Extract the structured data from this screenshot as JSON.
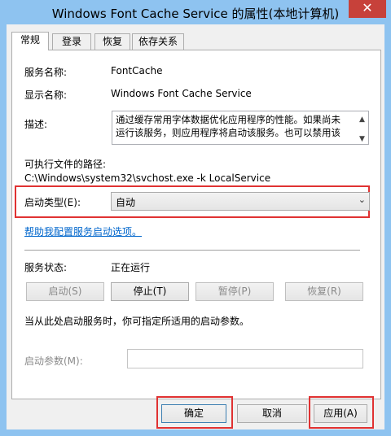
{
  "window": {
    "title": "Windows Font Cache Service 的属性(本地计算机)",
    "close_glyph": "✕"
  },
  "tabs": [
    {
      "label": "常规"
    },
    {
      "label": "登录"
    },
    {
      "label": "恢复"
    },
    {
      "label": "依存关系"
    }
  ],
  "general": {
    "service_name_label": "服务名称:",
    "service_name": "FontCache",
    "display_name_label": "显示名称:",
    "display_name": "Windows Font Cache Service",
    "description_label": "描述:",
    "description_line1": "通过缓存常用字体数据优化应用程序的性能。如果尚未",
    "description_line2": "运行该服务，则应用程序将启动该服务。也可以禁用该",
    "exec_path_label": "可执行文件的路径:",
    "exec_path": "C:\\Windows\\system32\\svchost.exe -k LocalService",
    "startup_type_label": "启动类型(E):",
    "startup_type_value": "自动",
    "help_link": "帮助我配置服务启动选项。",
    "service_status_label": "服务状态:",
    "service_status": "正在运行",
    "start_button": "启动(S)",
    "stop_button": "停止(T)",
    "pause_button": "暂停(P)",
    "resume_button": "恢复(R)",
    "start_params_hint": "当从此处启动服务时，你可指定所适用的启动参数。",
    "start_params_label": "启动参数(M):",
    "start_params_value": ""
  },
  "footer": {
    "ok_button": "确定",
    "cancel_button": "取消",
    "apply_button": "应用(A)"
  }
}
